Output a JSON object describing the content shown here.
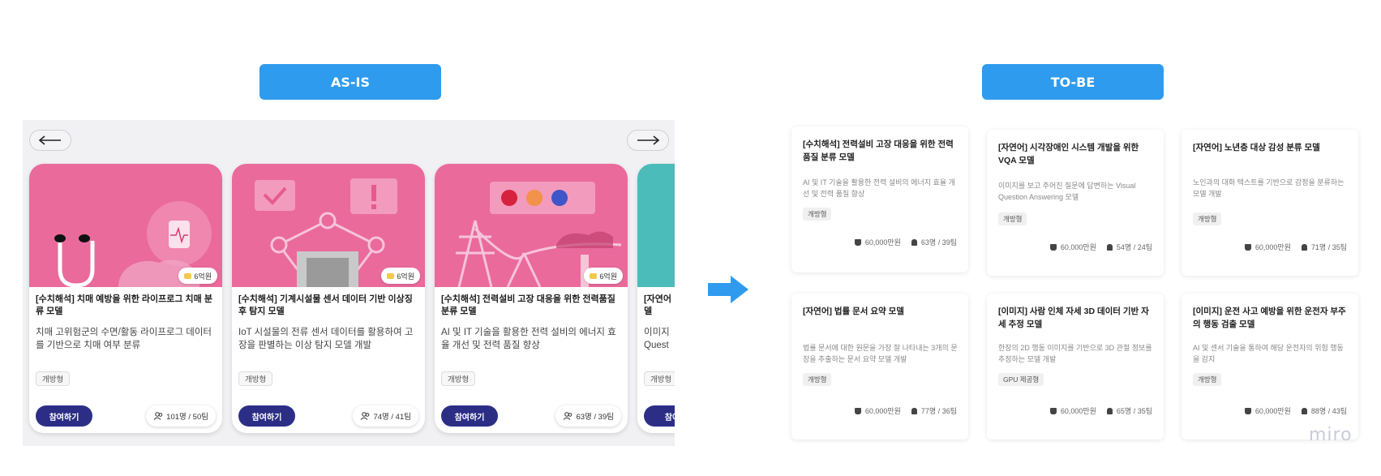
{
  "labels": {
    "asis": "AS-IS",
    "tobe": "TO-BE"
  },
  "asis_cards": [
    {
      "prize": "6억원",
      "title": "[수치해석] 치매 예방을 위한 라이프로그 치매 분류 모델",
      "desc": "치매 고위험군의 수면/활동 라이프로그 데이터를 기반으로 치매 여부 분류",
      "tag": "개방형",
      "button": "참여하기",
      "count": "101명 / 50팀",
      "image": "stethoscope-brain-watch"
    },
    {
      "prize": "6억원",
      "title": "[수치해석] 기계시설물 센서 데이터 기반 이상징후 탐지 모델",
      "desc": "IoT 시설물의 전류 센서 데이터를 활용하여 고장을 판별하는 이상 탐지 모델 개발",
      "tag": "개방형",
      "button": "참여하기",
      "count": "74명 / 41팀",
      "image": "network-check-alert"
    },
    {
      "prize": "6억원",
      "title": "[수치해석] 전력설비 고장 대응을 위한 전력품질 분류 모델",
      "desc": "AI 및 IT 기술을 활용한 전력 설비의 에너지 효율 개선 및 전력 품질 향상",
      "tag": "개방형",
      "button": "참여하기",
      "count": "63명 / 39팀",
      "image": "power-tower-lights"
    },
    {
      "title": "[자연어",
      "desc": "이미지\nQuest",
      "tag": "개방형",
      "button": "참여",
      "title2": "델"
    }
  ],
  "tobe_cards": [
    {
      "title": "[수치해석] 전력설비 고장 대응을 위한 전력품질 분류 모델",
      "desc": "AI 및 IT 기술을 활용한 전력 설비의 에너지 효율 개선 및 전력 품질 향상",
      "tag": "개방형",
      "prize": "60,000만원",
      "count": "63명 / 39팀"
    },
    {
      "title": "[자연어] 시각장애인 시스템 개발을 위한 VQA 모델",
      "desc": "이미지를 보고 주어진 질문에 답변하는 Visual Question Answering 모델",
      "tag": "개방형",
      "prize": "60,000만원",
      "count": "54명 / 24팀"
    },
    {
      "title": "[자연어] 노년층 대상 감성 분류 모델",
      "desc": "노인과의 대화 텍스트를 기반으로 감정을 분류하는 모델 개발",
      "tag": "개방형",
      "prize": "60,000만원",
      "count": "71명 / 35팀"
    },
    {
      "title": "[자연어] 법률 문서 요약 모델",
      "desc": "법률 문서에 대한 원문을 가장 잘 나타내는 3개의 문장을 추출하는 문서 요약 모델 개발",
      "tag": "개방형",
      "prize": "60,000만원",
      "count": "77명 / 36팀"
    },
    {
      "title": "[이미지] 사람 인체 자세 3D 데이터 기반 자세 추정 모델",
      "desc": "한장의 2D 행동 이미지를 기반으로 3D 관절 정보를 추정하는 모델 개발",
      "tag": "GPU 제공형",
      "prize": "60,000만원",
      "count": "65명 / 35팀"
    },
    {
      "title": "[이미지] 운전 사고 예방을 위한 운전자 부주의 행동 검출 모델",
      "desc": "AI 및 센서 기술을 통하여 해당 운전자의 위험 행동을 감지",
      "tag": "개방형",
      "prize": "60,000만원",
      "count": "88명 / 43팀"
    }
  ],
  "watermark": "miro",
  "colors": {
    "label_bg": "#2f9bef",
    "card_pink": "#ea6a9c",
    "join_btn": "#2c2e86",
    "teal": "#4bbcb9"
  },
  "icons": {
    "prev": "arrow-left-icon",
    "next": "arrow-right-icon",
    "transition": "blue-right-arrow-icon"
  }
}
